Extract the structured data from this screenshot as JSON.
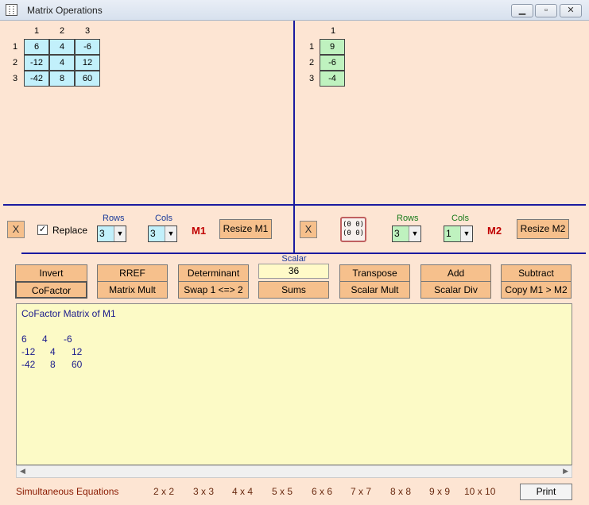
{
  "window": {
    "title": "Matrix Operations",
    "icon": "matrix-app-icon",
    "controls": [
      "minimize-icon",
      "maximize-icon",
      "close-icon"
    ]
  },
  "matrix1": {
    "col_headers": [
      "1",
      "2",
      "3"
    ],
    "row_headers": [
      "1",
      "2",
      "3"
    ],
    "cells": [
      [
        "6",
        "4",
        "-6"
      ],
      [
        "-12",
        "4",
        "12"
      ],
      [
        "-42",
        "8",
        "60"
      ]
    ]
  },
  "matrix2": {
    "col_headers": [
      "1"
    ],
    "row_headers": [
      "1",
      "2",
      "3"
    ],
    "cells": [
      [
        "9"
      ],
      [
        "-6"
      ],
      [
        "-4"
      ]
    ]
  },
  "m1_controls": {
    "x_label": "X",
    "replace_checked": "✓",
    "replace_label": "Replace",
    "rows_label": "Rows",
    "rows_value": "3",
    "cols_label": "Cols",
    "cols_value": "3",
    "name": "M1",
    "resize_label": "Resize M1"
  },
  "m2_controls": {
    "x_label": "X",
    "rows_label": "Rows",
    "rows_value": "3",
    "cols_label": "Cols",
    "cols_value": "1",
    "name": "M2",
    "resize_label": "Resize M2"
  },
  "scalar": {
    "label": "Scalar",
    "value": "36"
  },
  "operations": {
    "invert": "Invert",
    "rref": "RREF",
    "determinant": "Determinant",
    "transpose": "Transpose",
    "add": "Add",
    "subtract": "Subtract",
    "cofactor": "CoFactor",
    "matrix_mult": "Matrix Mult",
    "swap": "Swap 1 <=> 2",
    "sums": "Sums",
    "scalar_mult": "Scalar Mult",
    "scalar_div": "Scalar Div",
    "copy": "Copy M1 > M2"
  },
  "output": {
    "title": "CoFactor Matrix of M1",
    "rows": [
      [
        "6",
        "4",
        "-6"
      ],
      [
        "-12",
        "4",
        "12"
      ],
      [
        "-42",
        "8",
        "60"
      ]
    ]
  },
  "footer": {
    "label": "Simultaneous Equations",
    "sizes": [
      "2 x 2",
      "3 x 3",
      "4 x 4",
      "5 x 5",
      "6 x 6",
      "7 x 7",
      "8 x 8",
      "9 x 9",
      "10 x 10"
    ],
    "print": "Print"
  },
  "colors": {
    "background": "#fde5d3",
    "m1_cell": "#c2f0fb",
    "m2_cell": "#bff2bf",
    "button": "#f6c08c",
    "output_bg": "#fcfac6",
    "divider": "#1a1aa0",
    "matrix_name": "#c00000"
  }
}
